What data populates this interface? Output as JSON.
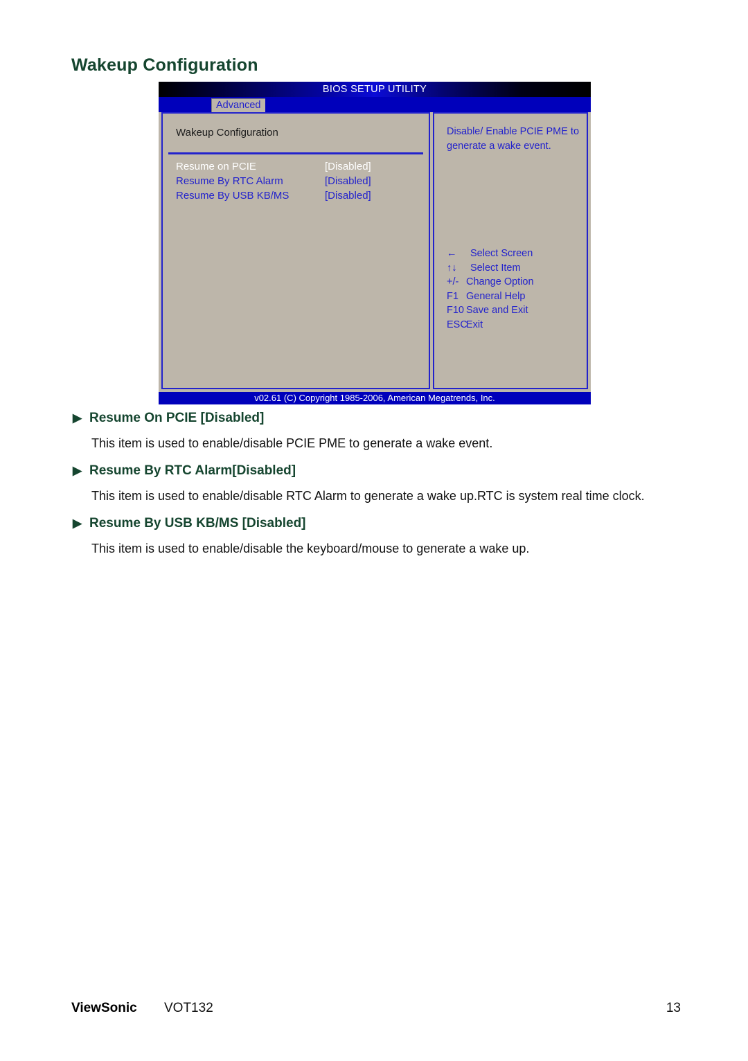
{
  "page": {
    "title": "Wakeup Configuration"
  },
  "bios": {
    "titlebar": "BIOS SETUP UTILITY",
    "active_tab": "Advanced",
    "section_heading": "Wakeup  Configuration",
    "options": [
      {
        "label": "Resume on PCIE",
        "value": "[Disabled]",
        "selected": true
      },
      {
        "label": "Resume By RTC Alarm",
        "value": "[Disabled]",
        "selected": false
      },
      {
        "label": "Resume By USB KB/MS",
        "value": "[Disabled]",
        "selected": false
      }
    ],
    "help_text": "Disable/ Enable PCIE PME to generate a wake event.",
    "keys": [
      {
        "key": "←",
        "desc": "Select Screen"
      },
      {
        "key": "↑↓",
        "desc": "Select Item"
      },
      {
        "key": "+/-",
        "desc": "Change Option"
      },
      {
        "key": "F1",
        "desc": "General Help"
      },
      {
        "key": "F10",
        "desc": "Save and Exit"
      },
      {
        "key": "ESC",
        "desc": "Exit"
      }
    ],
    "footer": "v02.61 (C) Copyright 1985-2006, American Megatrends, Inc."
  },
  "content": {
    "bullet_glyph": "▶",
    "items": [
      {
        "heading": "Resume On PCIE [Disabled]",
        "description": "This item is used to enable/disable PCIE PME to generate a wake event."
      },
      {
        "heading": "Resume By RTC Alarm[Disabled]",
        "description": "This item is used to enable/disable RTC Alarm to generate a wake up.RTC is system real time clock."
      },
      {
        "heading": "Resume By USB KB/MS [Disabled]",
        "description": "This item is used to enable/disable the keyboard/mouse to generate a wake up."
      }
    ]
  },
  "footer": {
    "brand": "ViewSonic",
    "model": "VOT132",
    "page_number": "13"
  }
}
